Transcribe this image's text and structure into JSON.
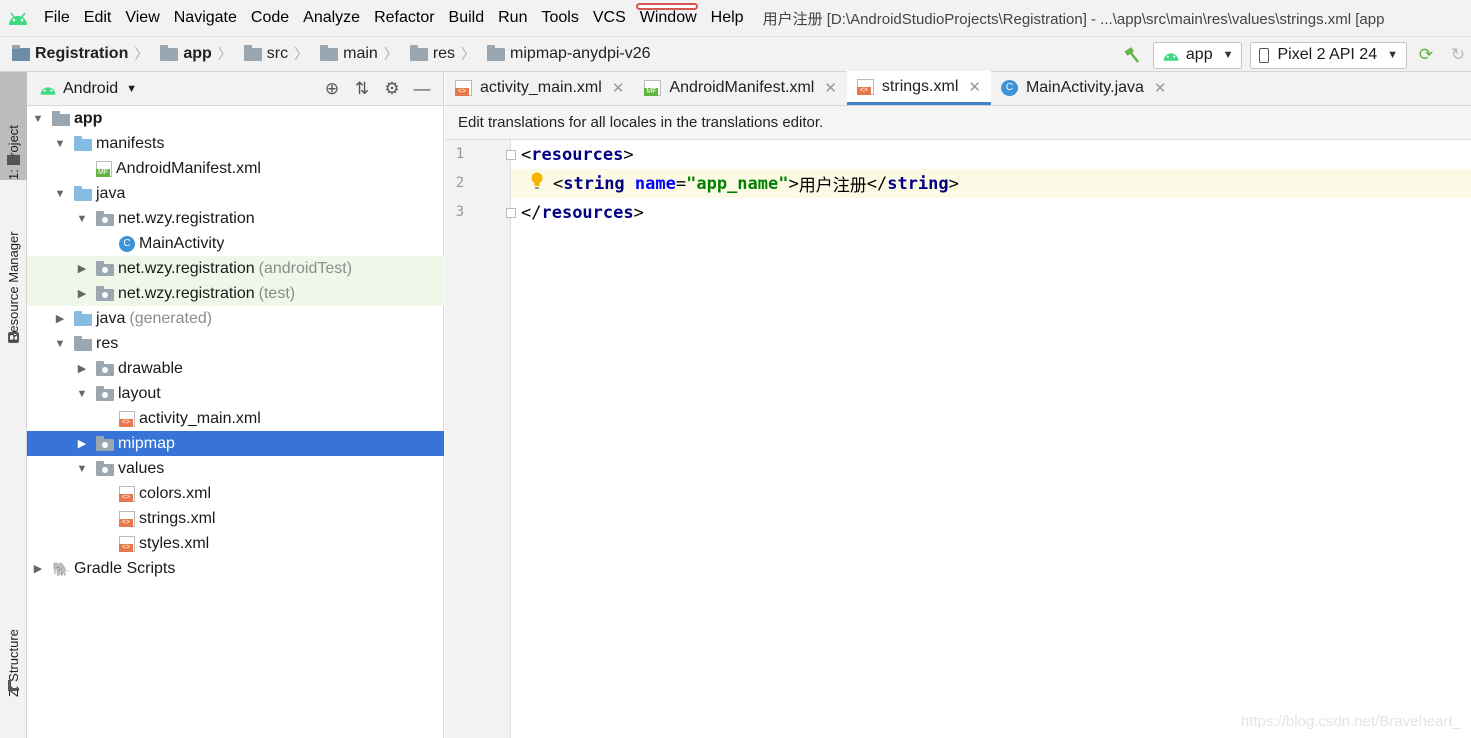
{
  "menubar": {
    "items": [
      "File",
      "Edit",
      "View",
      "Navigate",
      "Code",
      "Analyze",
      "Refactor",
      "Build",
      "Run",
      "Tools",
      "VCS",
      "Window",
      "Help"
    ],
    "window_title": "用户注册 [D:\\AndroidStudioProjects\\Registration] - ...\\app\\src\\main\\res\\values\\strings.xml [app"
  },
  "breadcrumb": {
    "project": "Registration",
    "module": "app",
    "path": [
      "src",
      "main",
      "res",
      "mipmap-anydpi-v26"
    ]
  },
  "toolbar": {
    "run_config": "app",
    "device": "Pixel 2 API 24"
  },
  "stripe": {
    "project_tab": "1: Project",
    "resource_manager_tab": "Resource Manager",
    "structure_tab": "Z: Structure"
  },
  "project_panel": {
    "view_mode": "Android",
    "tree": [
      {
        "label": "app",
        "muted": "",
        "bold": true
      },
      {
        "label": "manifests",
        "muted": ""
      },
      {
        "label": "AndroidManifest.xml",
        "muted": ""
      },
      {
        "label": "java",
        "muted": ""
      },
      {
        "label": "net.wzy.registration",
        "muted": ""
      },
      {
        "label": "MainActivity",
        "muted": ""
      },
      {
        "label": "net.wzy.registration",
        "muted": "(androidTest)"
      },
      {
        "label": "net.wzy.registration",
        "muted": "(test)"
      },
      {
        "label": "java",
        "muted": "(generated)"
      },
      {
        "label": "res",
        "muted": ""
      },
      {
        "label": "drawable",
        "muted": ""
      },
      {
        "label": "layout",
        "muted": ""
      },
      {
        "label": "activity_main.xml",
        "muted": ""
      },
      {
        "label": "mipmap",
        "muted": ""
      },
      {
        "label": "values",
        "muted": ""
      },
      {
        "label": "colors.xml",
        "muted": ""
      },
      {
        "label": "strings.xml",
        "muted": ""
      },
      {
        "label": "styles.xml",
        "muted": ""
      },
      {
        "label": "Gradle Scripts",
        "muted": ""
      }
    ]
  },
  "editor": {
    "tabs": [
      {
        "label": "activity_main.xml",
        "icon": "xml-file-icon"
      },
      {
        "label": "AndroidManifest.xml",
        "icon": "manifest-file-icon"
      },
      {
        "label": "strings.xml",
        "icon": "xml-file-icon",
        "active": true
      },
      {
        "label": "MainActivity.java",
        "icon": "java-class-icon"
      }
    ],
    "banner": "Edit translations for all locales in the translations editor.",
    "line_numbers": [
      "1",
      "2",
      "3"
    ],
    "code": {
      "l1_open": "<",
      "l1_tag": "resources",
      "l1_close": ">",
      "l2_indent": "  ",
      "l2_open": "<",
      "l2_tag": "string",
      "l2_attr": "name",
      "l2_eq": "=",
      "l2_val": "\"app_name\"",
      "l2_gt": ">",
      "l2_text": "用户注册",
      "l2_endopen": "</",
      "l2_endtag": "string",
      "l2_endclose": ">",
      "l3_open": "</",
      "l3_tag": "resources",
      "l3_close": ">"
    }
  },
  "watermark": "https://blog.csdn.net/Braveheart_",
  "colors": {
    "selection": "#3874d8",
    "tab_underline": "#4083c9",
    "current_line": "#fcfae5"
  }
}
